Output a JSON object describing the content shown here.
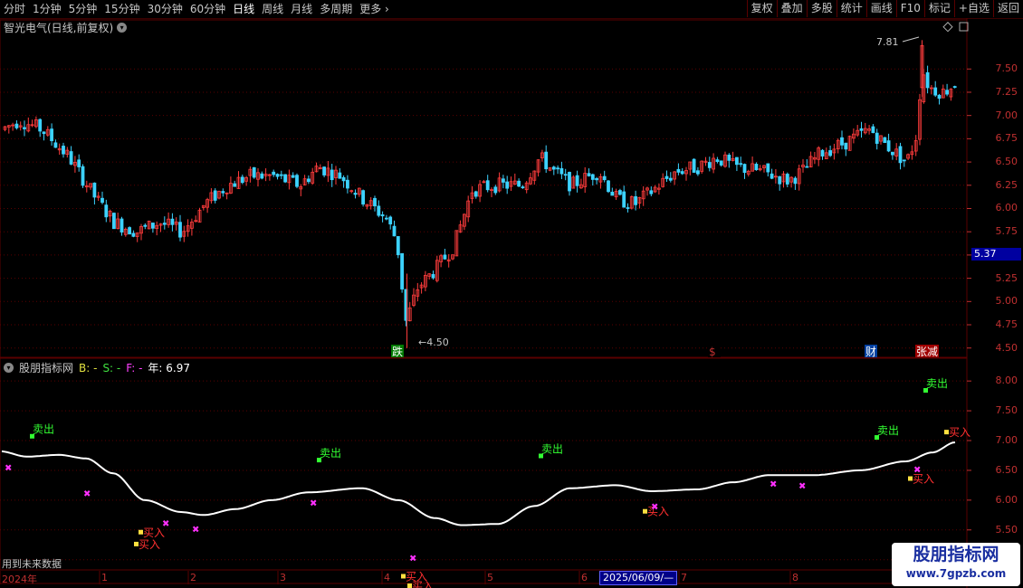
{
  "toolbar": {
    "periods": [
      "分时",
      "1分钟",
      "5分钟",
      "15分钟",
      "30分钟",
      "60分钟",
      "日线",
      "周线",
      "月线",
      "多周期",
      "更多"
    ],
    "active_period": "日线",
    "more_arrow": "›",
    "buttons": [
      "复权",
      "叠加",
      "多股",
      "统计",
      "画线",
      "F10",
      "标记",
      "+自选",
      "返回"
    ]
  },
  "main_chart": {
    "title": "智光电气(日线,前复权)",
    "title_icon": "chevron-down-icon",
    "y_ticks": [
      "7.50",
      "7.25",
      "7.00",
      "6.75",
      "6.50",
      "6.25",
      "6.00",
      "5.75",
      "5.50",
      "5.25",
      "5.00",
      "4.75",
      "4.50"
    ],
    "current_price": "5.37",
    "high_label": "7.81",
    "low_label": "4.50",
    "markers": [
      {
        "text": "跌",
        "bg": "#007a00",
        "color": "#ffffff"
      },
      {
        "text": "$",
        "bg": "#000000",
        "color": "#c03030"
      },
      {
        "text": "财",
        "bg": "#0040a0",
        "color": "#ffffff"
      },
      {
        "text": "张减",
        "bg": "#a00000",
        "color": "#ffffff"
      }
    ]
  },
  "indicator": {
    "name": "股朋指标网",
    "b_label": "B: -",
    "s_label": "S: -",
    "f_label": "F: -",
    "year_label": "年: 6.97",
    "y_ticks": [
      "8.00",
      "7.50",
      "7.00",
      "6.50",
      "6.00",
      "5.50",
      "5.00"
    ],
    "sell_label": "卖出",
    "buy_label": "买入"
  },
  "x_axis": {
    "labels": [
      "2024年",
      "1",
      "2",
      "3",
      "4",
      "5",
      "6",
      "7",
      "8"
    ],
    "cursor_date": "2025/06/09/—"
  },
  "footer_note": "用到未来数据",
  "watermark": {
    "line1": "股朋指标网",
    "line2": "www.7gpzb.com"
  },
  "colors": {
    "up": "#ff3c3c",
    "down": "#3cd2ff",
    "grid": "#5a0000",
    "axis_text": "#c03030",
    "sell": "#32ff32",
    "buy": "#ff3030",
    "magenta": "#ff30ff",
    "line": "#ffffff"
  }
}
